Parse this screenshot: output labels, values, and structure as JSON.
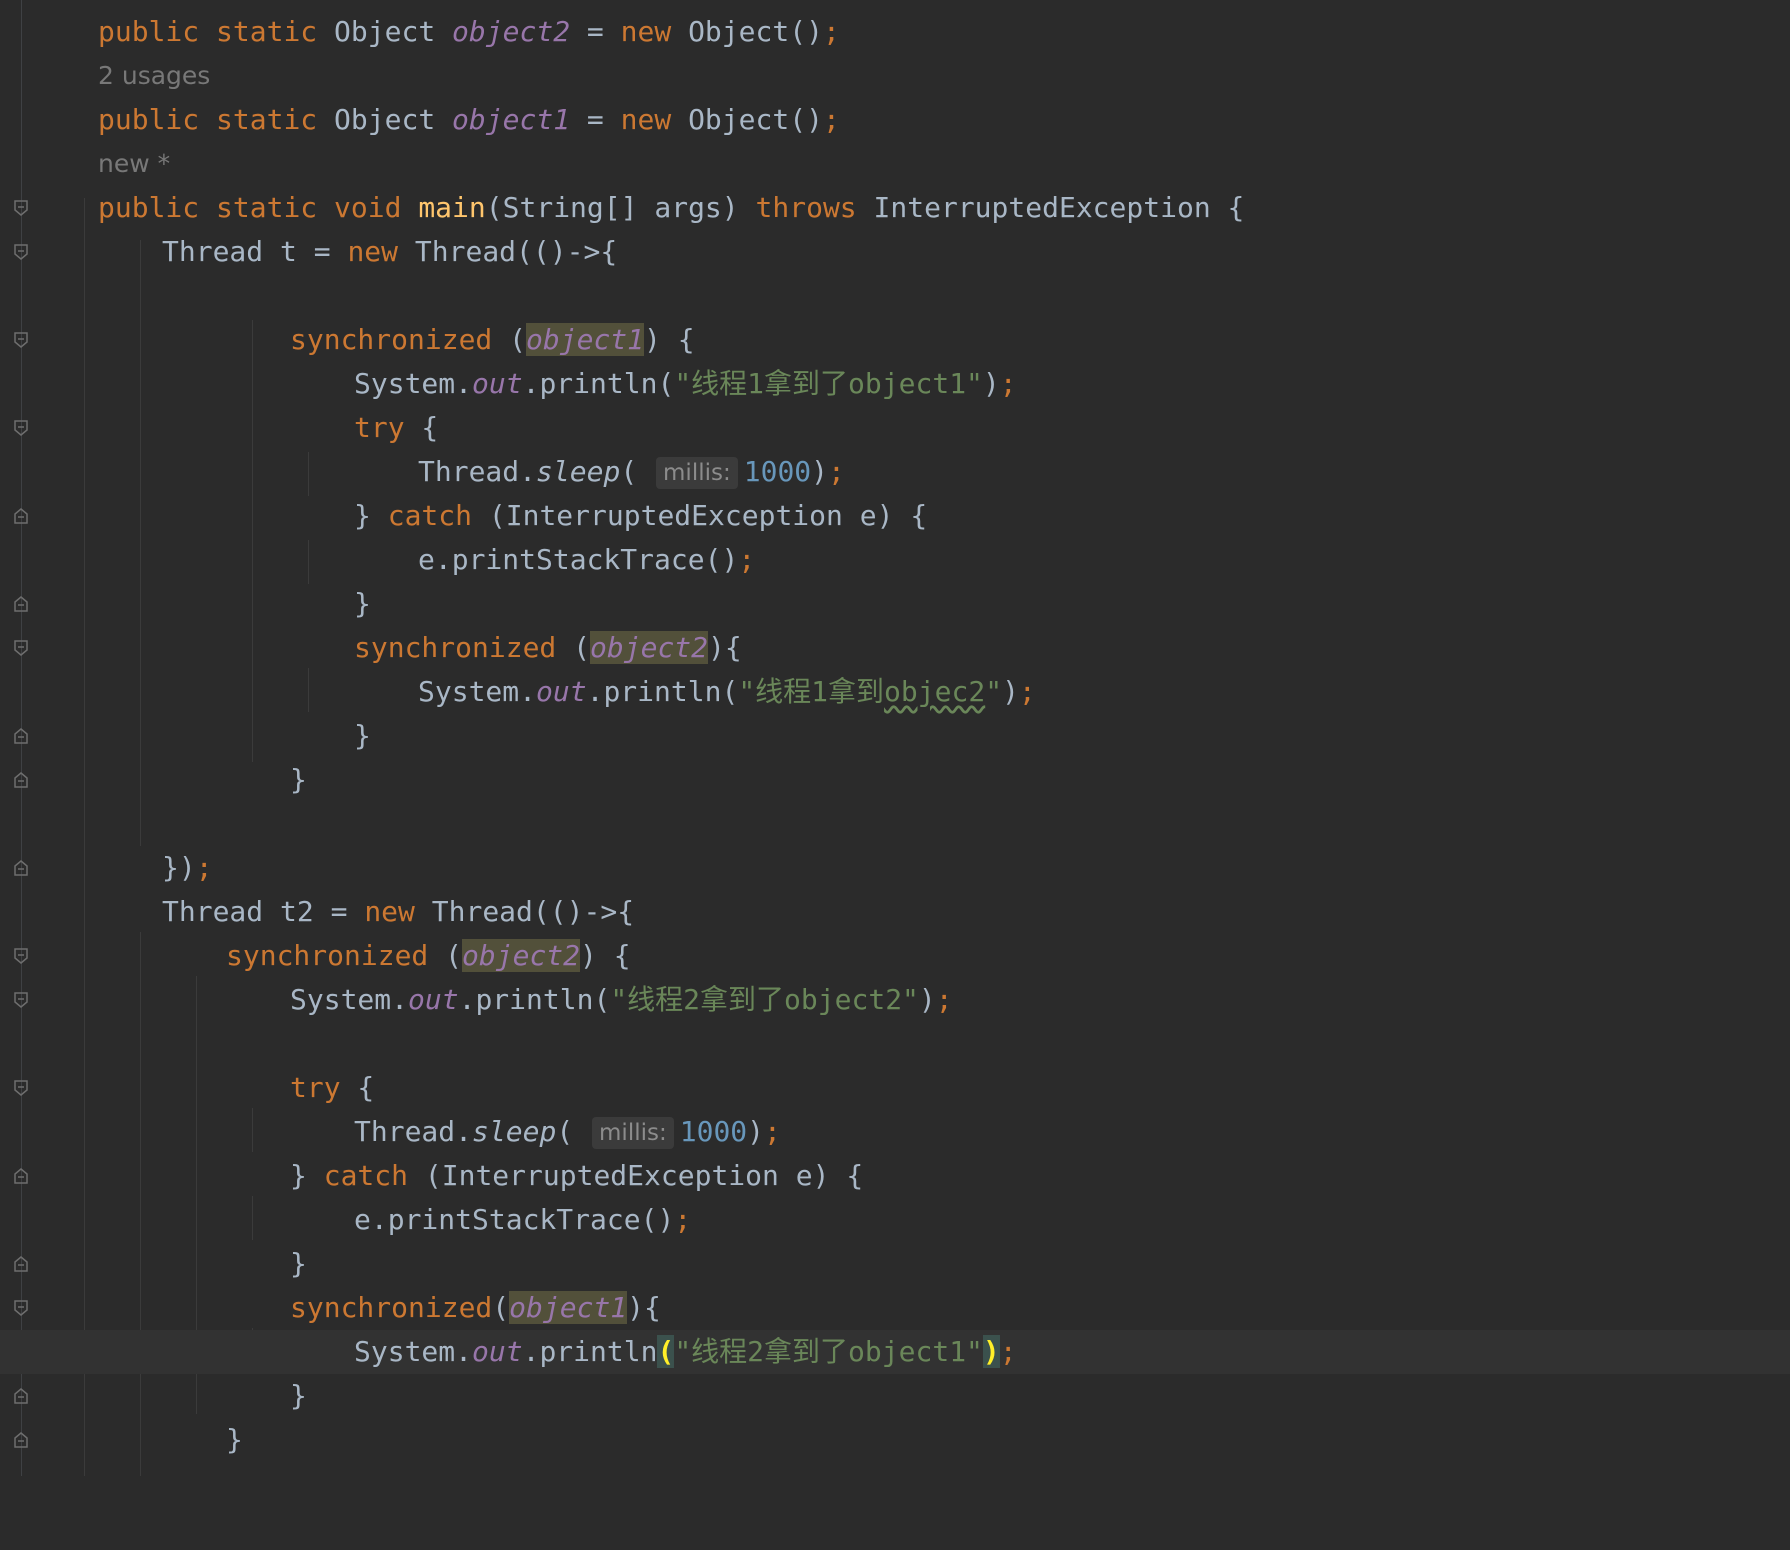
{
  "lines": [
    {
      "id": "l01",
      "text": "public static Object object2 = new Object();"
    },
    {
      "id": "l02",
      "text": "2 usages"
    },
    {
      "id": "l03",
      "text": "public static Object object1 = new Object();"
    },
    {
      "id": "l04",
      "text": "new *"
    },
    {
      "id": "l05",
      "text": "public static void main(String[] args) throws InterruptedException {"
    },
    {
      "id": "l06",
      "text": "Thread t = new Thread(()->{"
    },
    {
      "id": "l07",
      "text": "synchronized (object1) {"
    },
    {
      "id": "l08",
      "text": "System.out.println(\"线程1拿到了object1\");"
    },
    {
      "id": "l09",
      "text": "try {"
    },
    {
      "id": "l10",
      "text": "Thread.sleep( millis: 1000);"
    },
    {
      "id": "l11",
      "text": "} catch (InterruptedException e) {"
    },
    {
      "id": "l12",
      "text": "e.printStackTrace();"
    },
    {
      "id": "l13",
      "text": "synchronized (object2){"
    },
    {
      "id": "l14",
      "text": "System.out.println(\"线程1拿到objec2\");"
    },
    {
      "id": "l15",
      "text": "});"
    },
    {
      "id": "l16",
      "text": "Thread t2 = new Thread(()->{"
    },
    {
      "id": "l17",
      "text": "synchronized (object2) {"
    },
    {
      "id": "l18",
      "text": "System.out.println(\"线程2拿到了object2\");"
    },
    {
      "id": "l19",
      "text": "synchronized(object1){"
    },
    {
      "id": "l20",
      "text": "System.out.println(\"线程2拿到了object1\");"
    }
  ],
  "tokens": {
    "public": "public",
    "static": "static",
    "void": "void",
    "new": "new",
    "throws": "throws",
    "try": "try",
    "catch": "catch",
    "synchronized": "synchronized",
    "Object": "Object",
    "Thread": "Thread",
    "System": "System",
    "String": "String",
    "InterruptedException": "InterruptedException",
    "object1": "object1",
    "object2": "object2",
    "out": "out",
    "sleep": "sleep",
    "main": "main",
    "println": "println",
    "printStackTrace": "printStackTrace",
    "args": "args",
    "t": "t",
    "t2": "t2",
    "e": "e",
    "str_t1_o1": "\"线程1拿到了object1\"",
    "str_t1_o2_a": "\"线程1拿到",
    "str_t1_o2_b": "objec2",
    "str_t1_o2_c": "\"",
    "str_t2_o2": "\"线程2拿到了object2\"",
    "str_t2_o1": "\"线程2拿到了object1\"",
    "num_1000": "1000",
    "hint_millis": "millis:",
    "usages": "2 usages",
    "new_marker": "new *"
  },
  "theme": {
    "background": "#2b2b2b",
    "keyword": "#cc7832",
    "field": "#9876aa",
    "string": "#6a8759",
    "number": "#6897bb",
    "method_decl": "#ffc66d",
    "default_text": "#a9b7c6",
    "hint": "#787878",
    "ref_highlight": "#52503a",
    "current_line": "#323232"
  },
  "gutter": {
    "fold_icon": "fold-marker-icon"
  }
}
